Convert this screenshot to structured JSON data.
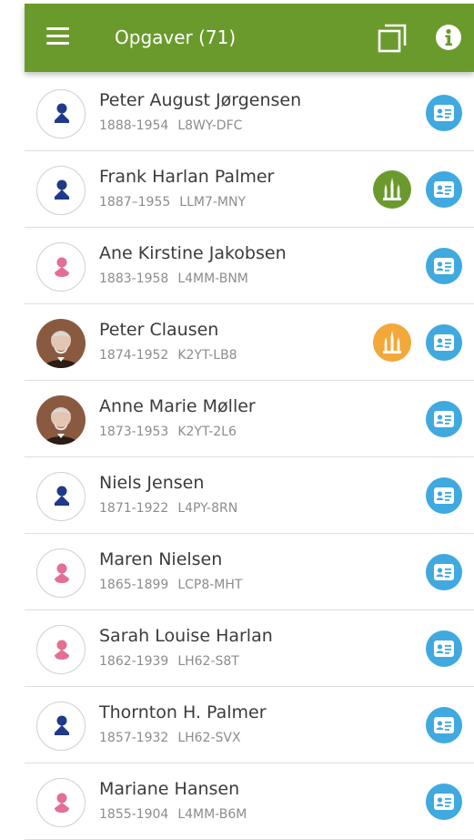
{
  "header": {
    "title": "Opgaver (71)",
    "icons": {
      "menu": "menu-icon",
      "copy": "copy-icon",
      "info": "info-icon"
    }
  },
  "colors": {
    "appbar": "#6b9a2c",
    "male": "#1f3a8a",
    "female": "#e36f93",
    "temple_green": "#6b9a2c",
    "temple_orange": "#f2a93a",
    "card_blue": "#3fa9e0"
  },
  "persons": [
    {
      "name": "Peter August Jørgensen",
      "years": "1888-1954",
      "pid": "L8WY-DFC",
      "avatar": "male",
      "temple": "none"
    },
    {
      "name": "Frank Harlan Palmer",
      "years": "1887–1955",
      "pid": "LLM7-MNY",
      "avatar": "male",
      "temple": "green"
    },
    {
      "name": "Ane Kirstine Jakobsen",
      "years": "1883-1958",
      "pid": "L4MM-BNM",
      "avatar": "female",
      "temple": "none"
    },
    {
      "name": "Peter Clausen",
      "years": "1874-1952",
      "pid": "K2YT-LB8",
      "avatar": "photo",
      "temple": "orange"
    },
    {
      "name": "Anne Marie Møller",
      "years": "1873-1953",
      "pid": "K2YT-2L6",
      "avatar": "photo",
      "temple": "none"
    },
    {
      "name": "Niels Jensen",
      "years": "1871-1922",
      "pid": "L4PY-8RN",
      "avatar": "male",
      "temple": "none"
    },
    {
      "name": "Maren Nielsen",
      "years": "1865-1899",
      "pid": "LCP8-MHT",
      "avatar": "female",
      "temple": "none"
    },
    {
      "name": "Sarah Louise Harlan",
      "years": "1862-1939",
      "pid": "LH62-S8T",
      "avatar": "female",
      "temple": "none"
    },
    {
      "name": "Thornton H. Palmer",
      "years": "1857-1932",
      "pid": "LH62-SVX",
      "avatar": "male",
      "temple": "none"
    },
    {
      "name": "Mariane Hansen",
      "years": "1855-1904",
      "pid": "L4MM-B6M",
      "avatar": "female",
      "temple": "none"
    }
  ]
}
